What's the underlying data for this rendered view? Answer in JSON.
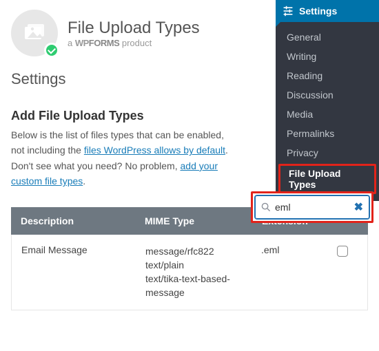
{
  "header": {
    "title": "File Upload Types",
    "subtitle_prefix": "a ",
    "subtitle_brand_wp": "WP",
    "subtitle_brand_forms": "FORMS",
    "subtitle_suffix": " product"
  },
  "page": {
    "heading": "Settings",
    "section_heading": "Add File Upload Types",
    "blurb_1": "Below is the list of files types that can be enabled, not including the ",
    "blurb_link_1": "files WordPress allows by default",
    "blurb_2": ". Don't see what you need? No problem, ",
    "blurb_link_2": "add your custom file types",
    "blurb_3": "."
  },
  "search": {
    "value": "eml",
    "placeholder": ""
  },
  "table": {
    "headers": {
      "desc": "Description",
      "mime": "MIME Type",
      "ext": "Extension"
    },
    "rows": [
      {
        "desc": "Email Message",
        "mime": "message/rfc822\ntext/plain\ntext/tika-text-based-message",
        "ext": ".eml",
        "checked": false
      }
    ]
  },
  "sidebar": {
    "title": "Settings",
    "items": [
      {
        "label": "General",
        "active": false
      },
      {
        "label": "Writing",
        "active": false
      },
      {
        "label": "Reading",
        "active": false
      },
      {
        "label": "Discussion",
        "active": false
      },
      {
        "label": "Media",
        "active": false
      },
      {
        "label": "Permalinks",
        "active": false
      },
      {
        "label": "Privacy",
        "active": false
      },
      {
        "label": "File Upload Types",
        "active": true
      }
    ]
  }
}
